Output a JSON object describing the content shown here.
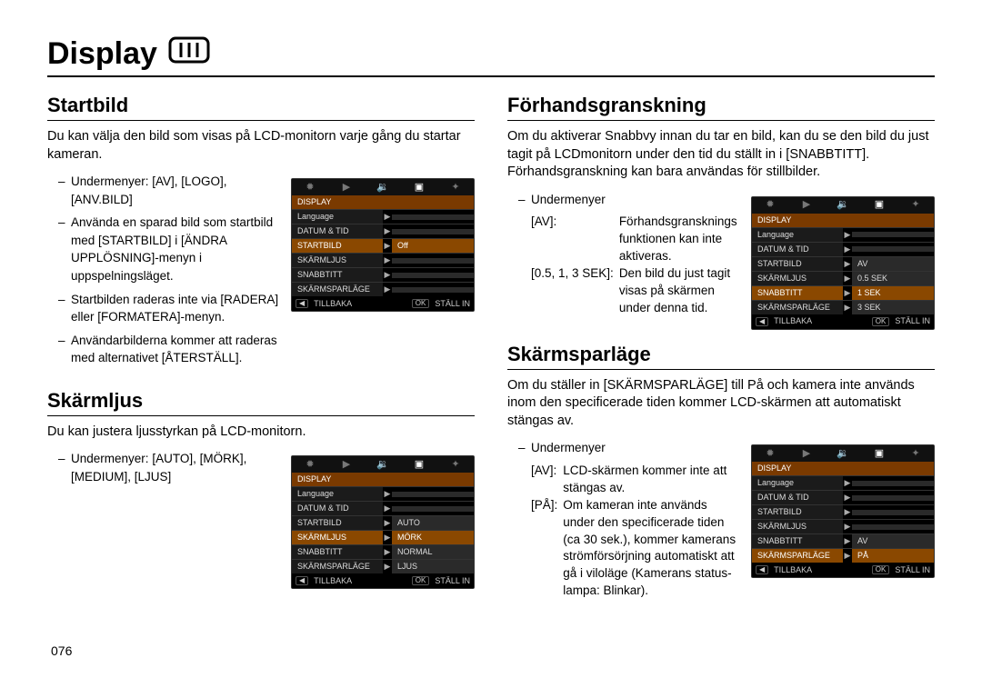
{
  "page_number": "076",
  "title": "Display",
  "left": {
    "section1": {
      "heading": "Startbild",
      "lead": "Du kan välja den bild som visas på LCD-monitorn varje gång du startar kameran.",
      "bullets": [
        "Undermenyer: [AV], [LOGO], [ANV.BILD]",
        "Använda en sparad bild som startbild med [STARTBILD] i [ÄNDRA UPPLÖSNING]-menyn i uppspelningsläget.",
        "Startbilden raderas inte via [RADERA] eller [FORMATERA]-menyn.",
        "Användarbilderna kommer att raderas med alternativet [ÅTERSTÄLL]."
      ],
      "shot": {
        "header": "DISPLAY",
        "rows": [
          {
            "c1": "Language",
            "arr": "▶",
            "c2": ""
          },
          {
            "c1": "DATUM & TID",
            "arr": "▶",
            "c2": ""
          },
          {
            "c1": "STARTBILD",
            "arr": "▶",
            "c2": "Off",
            "sel": true
          },
          {
            "c1": "SKÄRMLJUS",
            "arr": "▶",
            "c2": ""
          },
          {
            "c1": "SNABBTITT",
            "arr": "▶",
            "c2": ""
          },
          {
            "c1": "SKÄRMSPARLÄGE",
            "arr": "▶",
            "c2": ""
          }
        ],
        "foot_back": "TILLBAKA",
        "foot_ok": "STÄLL IN"
      }
    },
    "section2": {
      "heading": "Skärmljus",
      "lead": "Du kan justera ljusstyrkan på LCD-monitorn.",
      "bullet_label": "Undermenyer:",
      "bullet_vals": "[AUTO], [MÖRK], [MEDIUM], [LJUS]",
      "shot": {
        "header": "DISPLAY",
        "rows": [
          {
            "c1": "Language",
            "arr": "▶",
            "c2": ""
          },
          {
            "c1": "DATUM & TID",
            "arr": "▶",
            "c2": ""
          },
          {
            "c1": "STARTBILD",
            "arr": "▶",
            "c2": "AUTO"
          },
          {
            "c1": "SKÄRMLJUS",
            "arr": "▶",
            "c2": "MÖRK",
            "sel": true
          },
          {
            "c1": "SNABBTITT",
            "arr": "▶",
            "c2": "NORMAL"
          },
          {
            "c1": "SKÄRMSPARLÄGE",
            "arr": "▶",
            "c2": "LJUS"
          }
        ],
        "foot_back": "TILLBAKA",
        "foot_ok": "STÄLL IN"
      }
    }
  },
  "right": {
    "section1": {
      "heading": "Förhandsgranskning",
      "lead": "Om du aktiverar Snabbvy innan du tar en bild, kan du se den bild du just tagit på LCDmonitorn under den tid du ställt in i [SNABBTITT]. Förhandsgranskning kan bara användas för stillbilder.",
      "sub_label": "Undermenyer",
      "defs": [
        {
          "k": "[AV]:",
          "v": "Förhandsgransknings funktionen kan inte aktiveras."
        },
        {
          "k": "[0.5, 1, 3 SEK]:",
          "v": "Den bild du just tagit visas på skärmen under denna tid."
        }
      ],
      "shot": {
        "header": "DISPLAY",
        "rows": [
          {
            "c1": "Language",
            "arr": "▶",
            "c2": ""
          },
          {
            "c1": "DATUM & TID",
            "arr": "▶",
            "c2": ""
          },
          {
            "c1": "STARTBILD",
            "arr": "▶",
            "c2": "AV"
          },
          {
            "c1": "SKÄRMLJUS",
            "arr": "▶",
            "c2": "0.5 SEK"
          },
          {
            "c1": "SNABBTITT",
            "arr": "▶",
            "c2": "1 SEK",
            "sel": true
          },
          {
            "c1": "SKÄRMSPARLÄGE",
            "arr": "▶",
            "c2": "3 SEK"
          }
        ],
        "foot_back": "TILLBAKA",
        "foot_ok": "STÄLL IN"
      }
    },
    "section2": {
      "heading": "Skärmsparläge",
      "lead": "Om du ställer in [SKÄRMSPARLÄGE] till På och kamera inte används inom den specificerade tiden kommer LCD-skärmen att automatiskt stängas av.",
      "sub_label": "Undermenyer",
      "defs": [
        {
          "k": "[AV]:",
          "v": "LCD-skärmen kommer inte att stängas av."
        },
        {
          "k": "[PÅ]:",
          "v": "Om kameran inte används under den specificerade tiden (ca 30 sek.), kommer kamerans strömförsörjning automatiskt att gå i viloläge (Kamerans status-lampa: Blinkar)."
        }
      ],
      "shot": {
        "header": "DISPLAY",
        "rows": [
          {
            "c1": "Language",
            "arr": "▶",
            "c2": ""
          },
          {
            "c1": "DATUM & TID",
            "arr": "▶",
            "c2": ""
          },
          {
            "c1": "STARTBILD",
            "arr": "▶",
            "c2": ""
          },
          {
            "c1": "SKÄRMLJUS",
            "arr": "▶",
            "c2": ""
          },
          {
            "c1": "SNABBTITT",
            "arr": "▶",
            "c2": "AV"
          },
          {
            "c1": "SKÄRMSPARLÄGE",
            "arr": "▶",
            "c2": "PÅ",
            "sel": true
          }
        ],
        "foot_back": "TILLBAKA",
        "foot_ok": "STÄLL IN"
      }
    }
  },
  "icons": {
    "play": "▶",
    "back": "◀",
    "ok": "OK",
    "speaker": "🔊",
    "screen": "▣",
    "camera": "✹"
  }
}
